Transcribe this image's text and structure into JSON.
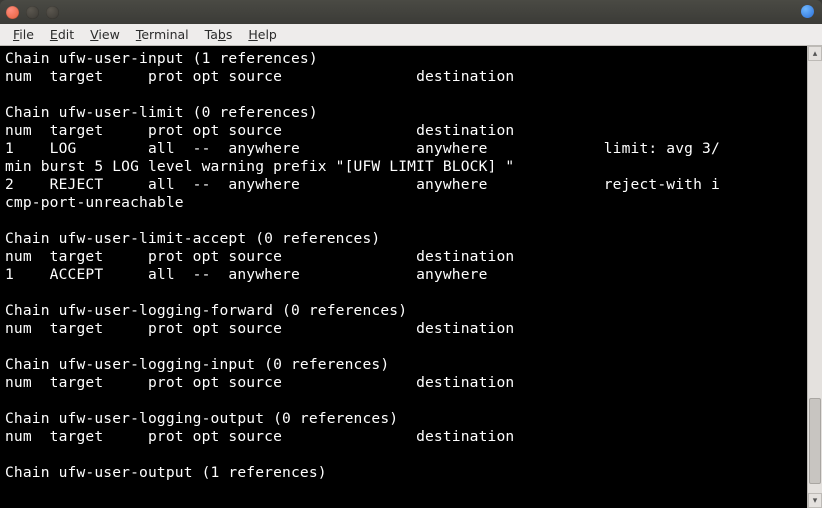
{
  "menu": {
    "file": "File",
    "edit": "Edit",
    "view": "View",
    "terminal": "Terminal",
    "tabs": "Tabs",
    "help": "Help"
  },
  "colors": {
    "terminal_bg": "#000000",
    "terminal_fg": "#ffffff",
    "titlebar_bg": "#3b3b37",
    "menubar_bg": "#eeeceb"
  },
  "terminal_lines": [
    "Chain ufw-user-input (1 references)",
    "num  target     prot opt source               destination",
    "",
    "Chain ufw-user-limit (0 references)",
    "num  target     prot opt source               destination",
    "1    LOG        all  --  anywhere             anywhere             limit: avg 3/",
    "min burst 5 LOG level warning prefix \"[UFW LIMIT BLOCK] \"",
    "2    REJECT     all  --  anywhere             anywhere             reject-with i",
    "cmp-port-unreachable",
    "",
    "Chain ufw-user-limit-accept (0 references)",
    "num  target     prot opt source               destination",
    "1    ACCEPT     all  --  anywhere             anywhere",
    "",
    "Chain ufw-user-logging-forward (0 references)",
    "num  target     prot opt source               destination",
    "",
    "Chain ufw-user-logging-input (0 references)",
    "num  target     prot opt source               destination",
    "",
    "Chain ufw-user-logging-output (0 references)",
    "num  target     prot opt source               destination",
    "",
    "Chain ufw-user-output (1 references)"
  ]
}
